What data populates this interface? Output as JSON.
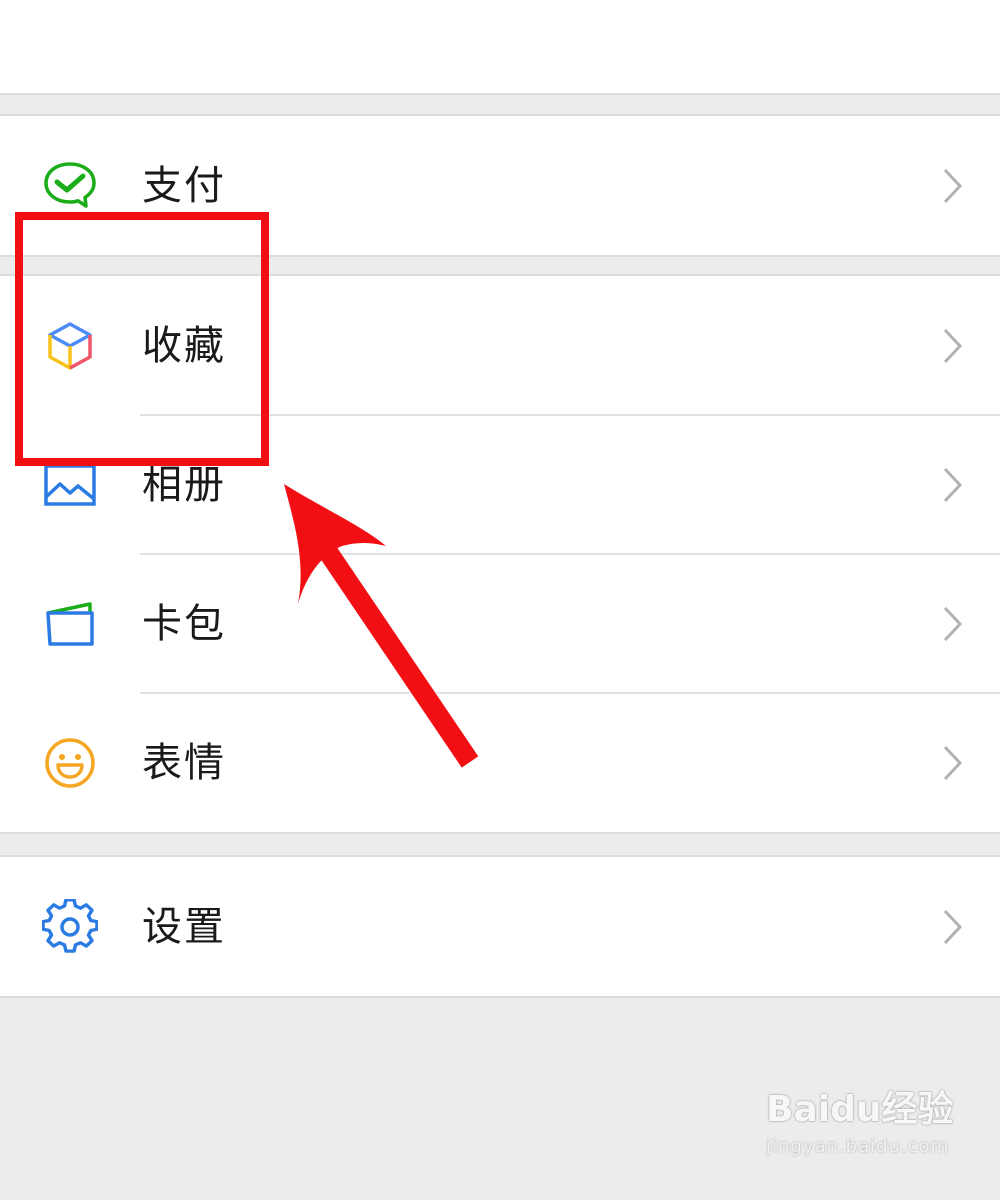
{
  "menu": {
    "group1": [
      {
        "label": "支付",
        "icon": "wechat-pay-icon",
        "color": "#1aad19"
      }
    ],
    "group2": [
      {
        "label": "收藏",
        "icon": "favorites-cube-icon",
        "color": "#4c8bf5"
      },
      {
        "label": "相册",
        "icon": "album-icon",
        "color": "#2b7be4"
      },
      {
        "label": "卡包",
        "icon": "card-wallet-icon",
        "color": "#2b7be4"
      },
      {
        "label": "表情",
        "icon": "sticker-smile-icon",
        "color": "#f5a623"
      }
    ],
    "group3": [
      {
        "label": "设置",
        "icon": "settings-gear-icon",
        "color": "#2b7be4"
      }
    ]
  },
  "annotation": {
    "color": "#f10f14",
    "highlighted_item": "收藏"
  },
  "watermark": {
    "main": "Baidu经验",
    "sub": "jingyan.baidu.com"
  }
}
